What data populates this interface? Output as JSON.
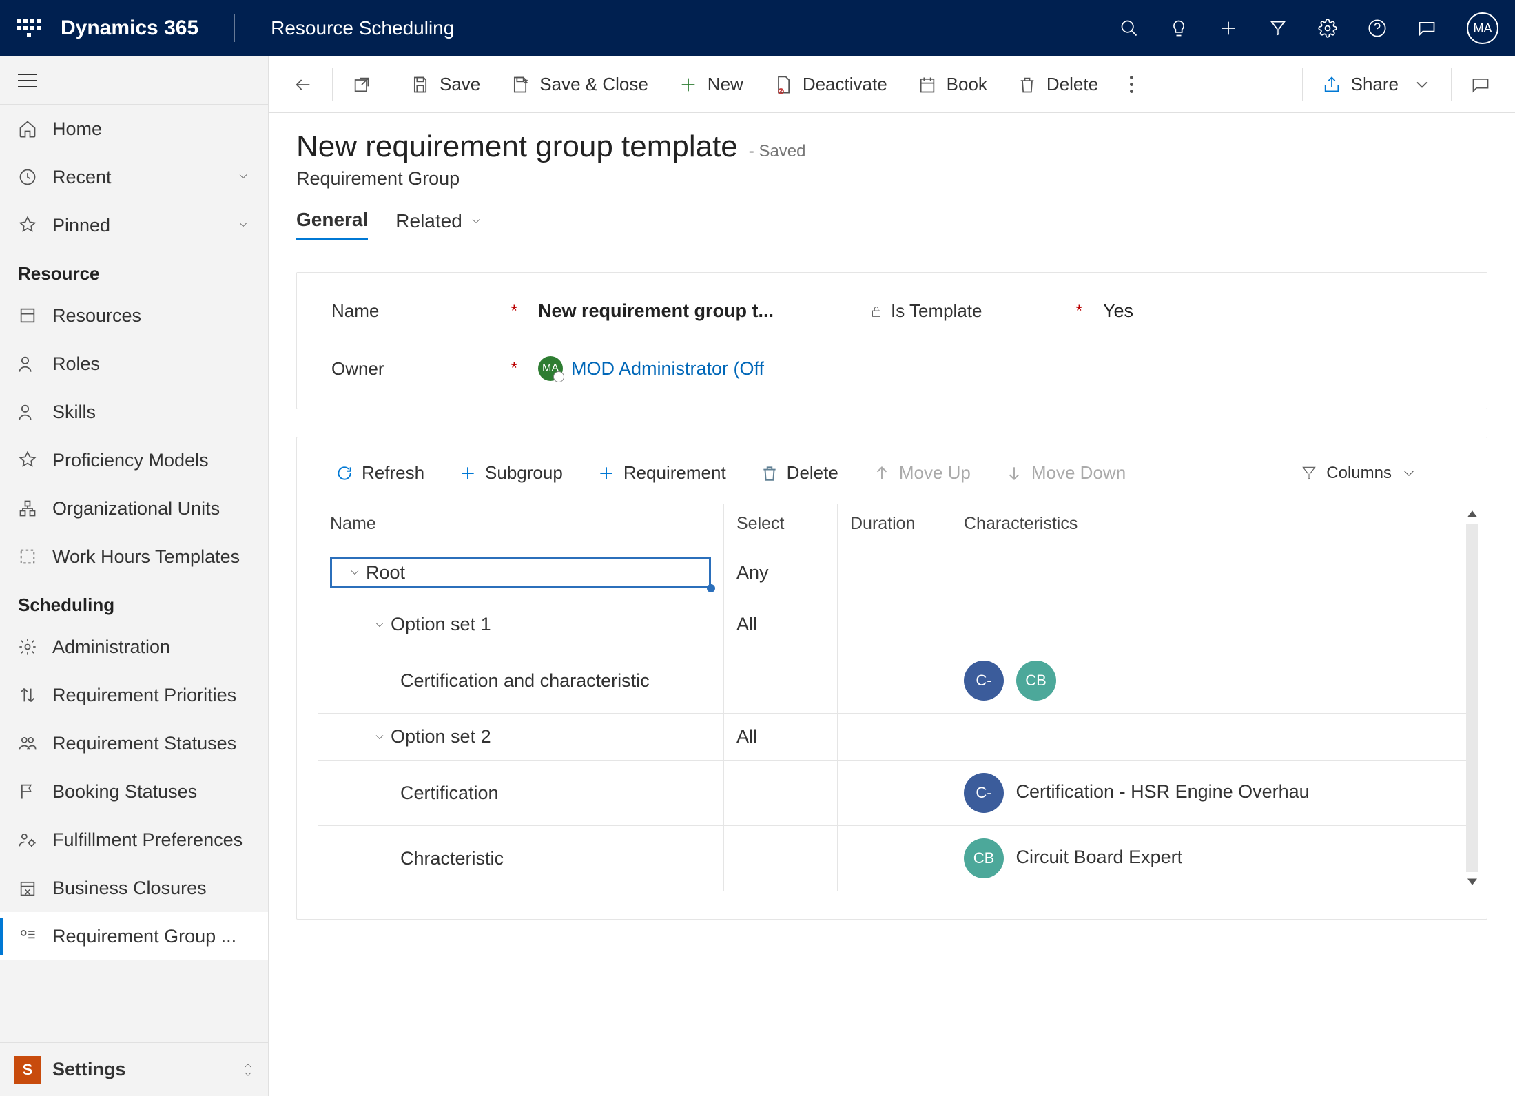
{
  "topbar": {
    "app_name": "Dynamics 365",
    "module": "Resource Scheduling",
    "avatar_initials": "MA"
  },
  "sidebar": {
    "items_top": {
      "home": "Home",
      "recent": "Recent",
      "pinned": "Pinned"
    },
    "section_resource": "Resource",
    "resource_items": {
      "resources": "Resources",
      "roles": "Roles",
      "skills": "Skills",
      "proficiency": "Proficiency Models",
      "org_units": "Organizational Units",
      "work_hours": "Work Hours Templates"
    },
    "section_scheduling": "Scheduling",
    "scheduling_items": {
      "administration": "Administration",
      "req_priorities": "Requirement Priorities",
      "req_statuses": "Requirement Statuses",
      "booking_statuses": "Booking Statuses",
      "fulfillment": "Fulfillment Preferences",
      "business_closures": "Business Closures",
      "req_group": "Requirement Group ..."
    },
    "area": "Settings",
    "area_initial": "S"
  },
  "cmd": {
    "save": "Save",
    "save_close": "Save & Close",
    "new": "New",
    "deactivate": "Deactivate",
    "book": "Book",
    "delete": "Delete",
    "share": "Share"
  },
  "page": {
    "title": "New requirement group template",
    "saved": "- Saved",
    "entity": "Requirement Group",
    "tabs": {
      "general": "General",
      "related": "Related"
    }
  },
  "form": {
    "name_label": "Name",
    "name_value": "New requirement group t...",
    "istemplate_label": "Is Template",
    "istemplate_value": "Yes",
    "owner_label": "Owner",
    "owner_display": "MOD Administrator (Off",
    "owner_initials": "MA"
  },
  "subgrid": {
    "toolbar": {
      "refresh": "Refresh",
      "subgroup": "Subgroup",
      "requirement": "Requirement",
      "delete": "Delete",
      "moveup": "Move Up",
      "movedown": "Move Down",
      "columns": "Columns"
    },
    "headers": {
      "name": "Name",
      "select": "Select",
      "duration": "Duration",
      "characteristics": "Characteristics"
    },
    "rows": {
      "root": {
        "name": "Root",
        "select": "Any"
      },
      "opt1": {
        "name": "Option set 1",
        "select": "All"
      },
      "cert_char": {
        "name": "Certification and characteristic",
        "c1": "C-",
        "c2": "CB"
      },
      "opt2": {
        "name": "Option set 2",
        "select": "All"
      },
      "cert": {
        "name": "Certification",
        "c1": "C-",
        "char_text": "Certification - HSR Engine Overhau"
      },
      "char": {
        "name": "Chracteristic",
        "c1": "CB",
        "char_text": "Circuit Board Expert"
      }
    }
  }
}
